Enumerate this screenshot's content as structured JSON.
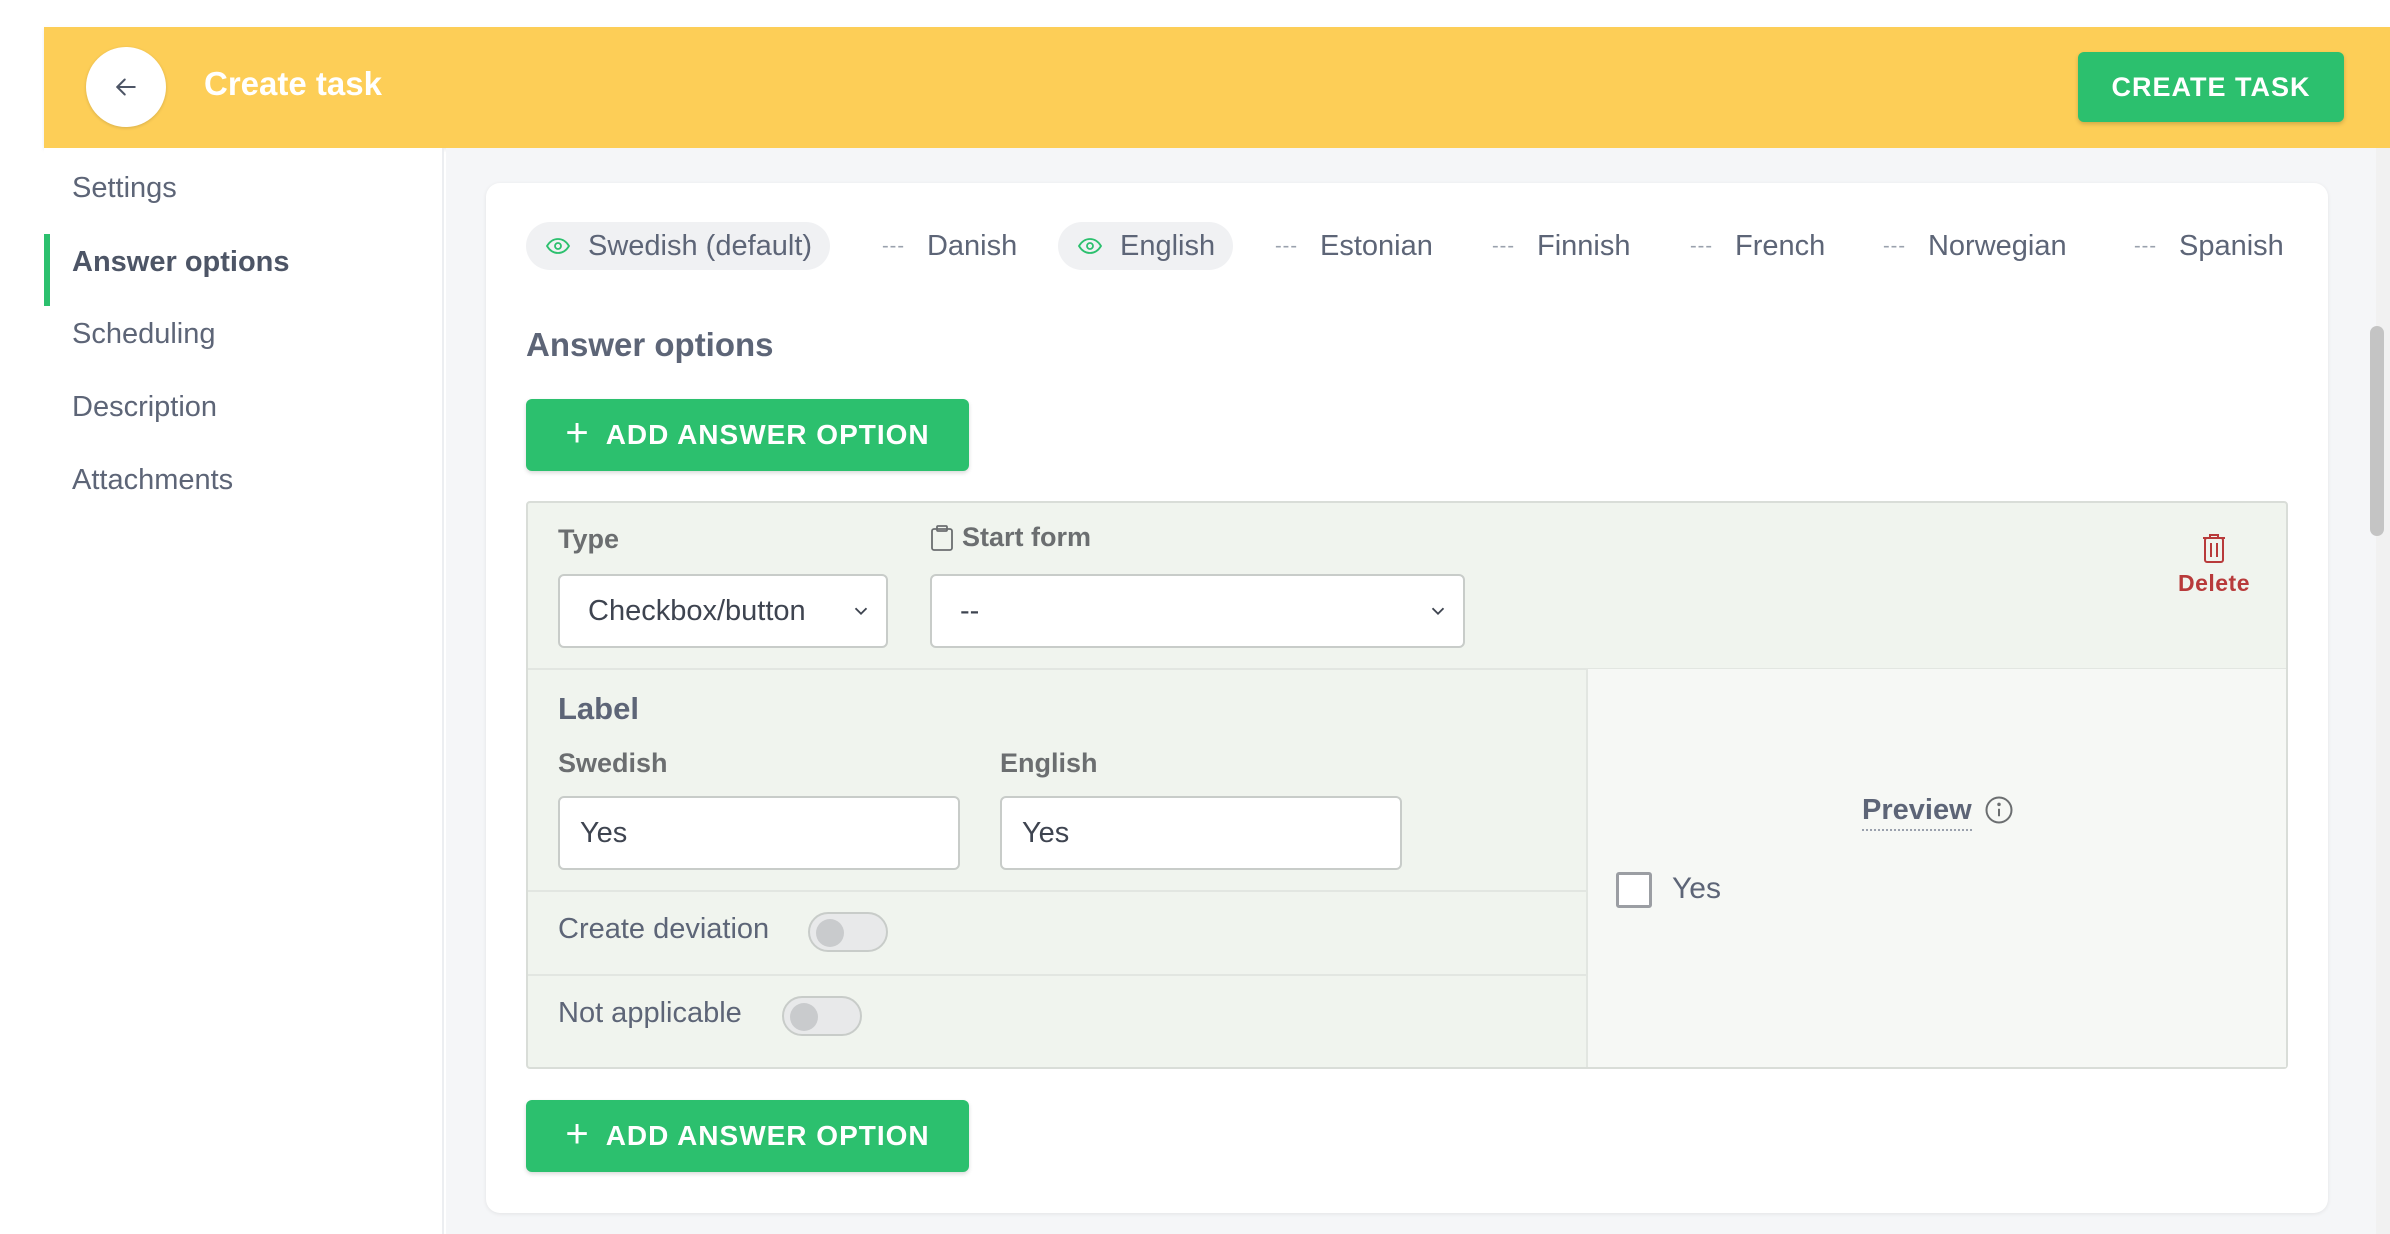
{
  "header": {
    "title": "Create task",
    "create_label": "CREATE TASK"
  },
  "sidebar": {
    "items": [
      {
        "label": "Settings",
        "active": false
      },
      {
        "label": "Answer options",
        "active": true
      },
      {
        "label": "Scheduling",
        "active": false
      },
      {
        "label": "Description",
        "active": false
      },
      {
        "label": "Attachments",
        "active": false
      }
    ]
  },
  "languages": [
    {
      "label": "Swedish (default)",
      "visible": true
    },
    {
      "label": "Danish",
      "visible": false
    },
    {
      "label": "English",
      "visible": true
    },
    {
      "label": "Estonian",
      "visible": false
    },
    {
      "label": "Finnish",
      "visible": false
    },
    {
      "label": "French",
      "visible": false
    },
    {
      "label": "Norwegian",
      "visible": false
    },
    {
      "label": "Spanish",
      "visible": false
    }
  ],
  "language_hidden_mark": "---",
  "section": {
    "title": "Answer options",
    "add_label": "ADD ANSWER OPTION"
  },
  "option": {
    "type_label": "Type",
    "type_value": "Checkbox/button",
    "start_form_label": "Start form",
    "start_form_value": "--",
    "delete_label": "Delete",
    "label_title": "Label",
    "swedish_label": "Swedish",
    "swedish_value": "Yes",
    "english_label": "English",
    "english_value": "Yes",
    "create_deviation_label": "Create deviation",
    "create_deviation_on": false,
    "not_applicable_label": "Not applicable",
    "not_applicable_on": false
  },
  "preview": {
    "title": "Preview",
    "checkbox_label": "Yes"
  },
  "colors": {
    "header_bg": "#fdce57",
    "accent_green": "#2cc06e",
    "delete_red": "#b83a3a",
    "option_bg": "#f0f4ee"
  }
}
